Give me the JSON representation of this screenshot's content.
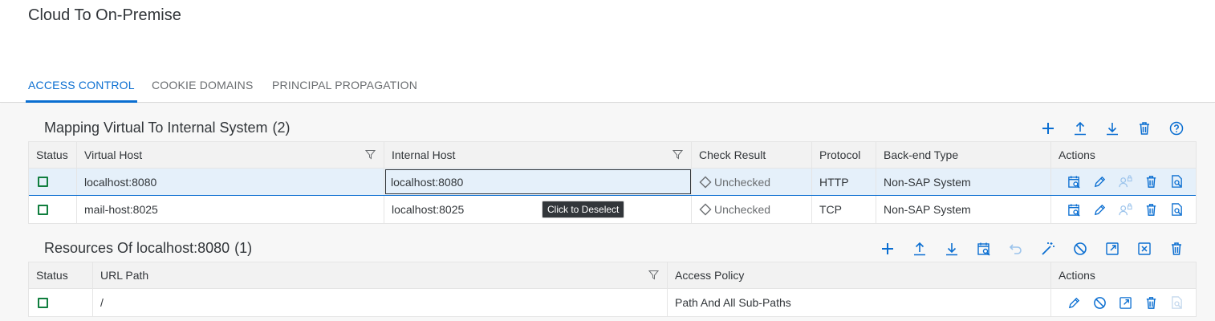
{
  "page": {
    "title": "Cloud To On-Premise"
  },
  "tabs": [
    {
      "label": "ACCESS CONTROL",
      "active": true
    },
    {
      "label": "COOKIE DOMAINS",
      "active": false
    },
    {
      "label": "PRINCIPAL PROPAGATION",
      "active": false
    }
  ],
  "mapping": {
    "title": "Mapping Virtual To Internal System",
    "count": "(2)",
    "toolbar": [
      "add-icon",
      "upload-icon",
      "download-icon",
      "delete-icon",
      "help-icon"
    ],
    "columns": {
      "status": "Status",
      "virtual_host": "Virtual Host",
      "internal_host": "Internal Host",
      "check_result": "Check Result",
      "protocol": "Protocol",
      "backend_type": "Back-end Type",
      "actions": "Actions"
    },
    "rows": [
      {
        "virtual_host": "localhost:8080",
        "internal_host": "localhost:8080",
        "check_result": "Unchecked",
        "protocol": "HTTP",
        "backend_type": "Non-SAP System",
        "selected": true
      },
      {
        "virtual_host": "mail-host:8025",
        "internal_host": "localhost:8025",
        "check_result": "Unchecked",
        "protocol": "TCP",
        "backend_type": "Non-SAP System",
        "selected": false
      }
    ]
  },
  "tooltip": {
    "text": "Click to Deselect"
  },
  "resources": {
    "title": "Resources Of localhost:8080",
    "count": "(1)",
    "toolbar": [
      "add-icon",
      "upload-icon",
      "download-icon",
      "check-availability-icon",
      "undo-icon",
      "magic-wand-icon",
      "disable-icon",
      "open-icon",
      "cancel-icon",
      "delete-icon"
    ],
    "columns": {
      "status": "Status",
      "url_path": "URL Path",
      "access_policy": "Access Policy",
      "actions": "Actions"
    },
    "rows": [
      {
        "url_path": "/",
        "access_policy": "Path And All Sub-Paths"
      }
    ]
  },
  "colors": {
    "accent": "#0a6ed1",
    "status_green": "#107e3e",
    "selected_row": "#e5f0fa"
  }
}
